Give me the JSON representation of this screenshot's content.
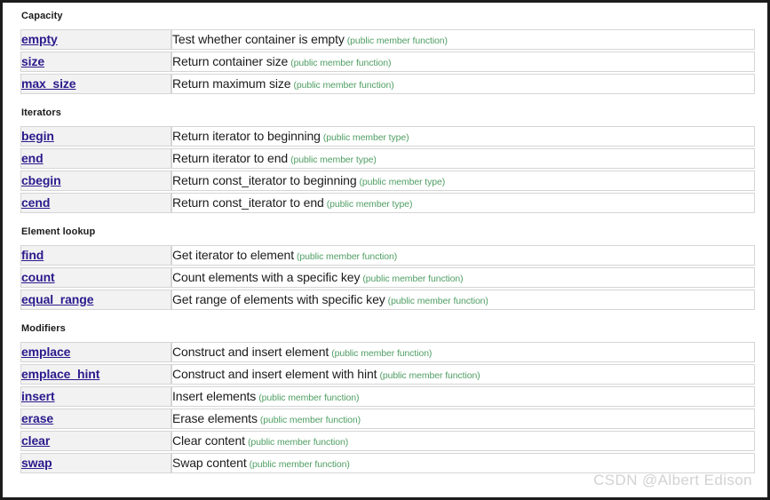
{
  "watermark": "CSDN @Albert Edison",
  "sections": [
    {
      "title": "Capacity",
      "rows": [
        {
          "name": "empty",
          "desc": "Test whether container is empty",
          "kind": "(public member function)"
        },
        {
          "name": "size",
          "desc": "Return container size",
          "kind": "(public member function)"
        },
        {
          "name": "max_size",
          "desc": "Return maximum size",
          "kind": "(public member function)"
        }
      ]
    },
    {
      "title": "Iterators",
      "rows": [
        {
          "name": "begin",
          "desc": "Return iterator to beginning",
          "kind": "(public member type)"
        },
        {
          "name": "end",
          "desc": "Return iterator to end",
          "kind": "(public member type)"
        },
        {
          "name": "cbegin",
          "desc": "Return const_iterator to beginning",
          "kind": "(public member type)"
        },
        {
          "name": "cend",
          "desc": "Return const_iterator to end",
          "kind": "(public member type)"
        }
      ]
    },
    {
      "title": "Element lookup",
      "rows": [
        {
          "name": "find",
          "desc": "Get iterator to element",
          "kind": "(public member function)"
        },
        {
          "name": "count",
          "desc": "Count elements with a specific key",
          "kind": "(public member function)"
        },
        {
          "name": "equal_range",
          "desc": "Get range of elements with specific key",
          "kind": "(public member function)"
        }
      ]
    },
    {
      "title": "Modifiers",
      "rows": [
        {
          "name": "emplace",
          "desc": "Construct and insert element",
          "kind": "(public member function)"
        },
        {
          "name": "emplace_hint",
          "desc": "Construct and insert element with hint",
          "kind": "(public member function)"
        },
        {
          "name": "insert",
          "desc": "Insert elements",
          "kind": "(public member function)"
        },
        {
          "name": "erase",
          "desc": "Erase elements",
          "kind": "(public member function)"
        },
        {
          "name": "clear",
          "desc": "Clear content",
          "kind": "(public member function)"
        },
        {
          "name": "swap",
          "desc": "Swap content",
          "kind": "(public member function)"
        }
      ]
    }
  ],
  "colors": {
    "link": "#2a1a8c",
    "kind_green": "#4f9e63",
    "name_cell_bg": "#f2f2f2",
    "border": "#d5d5d5",
    "watermark": "#d2d2d2"
  }
}
